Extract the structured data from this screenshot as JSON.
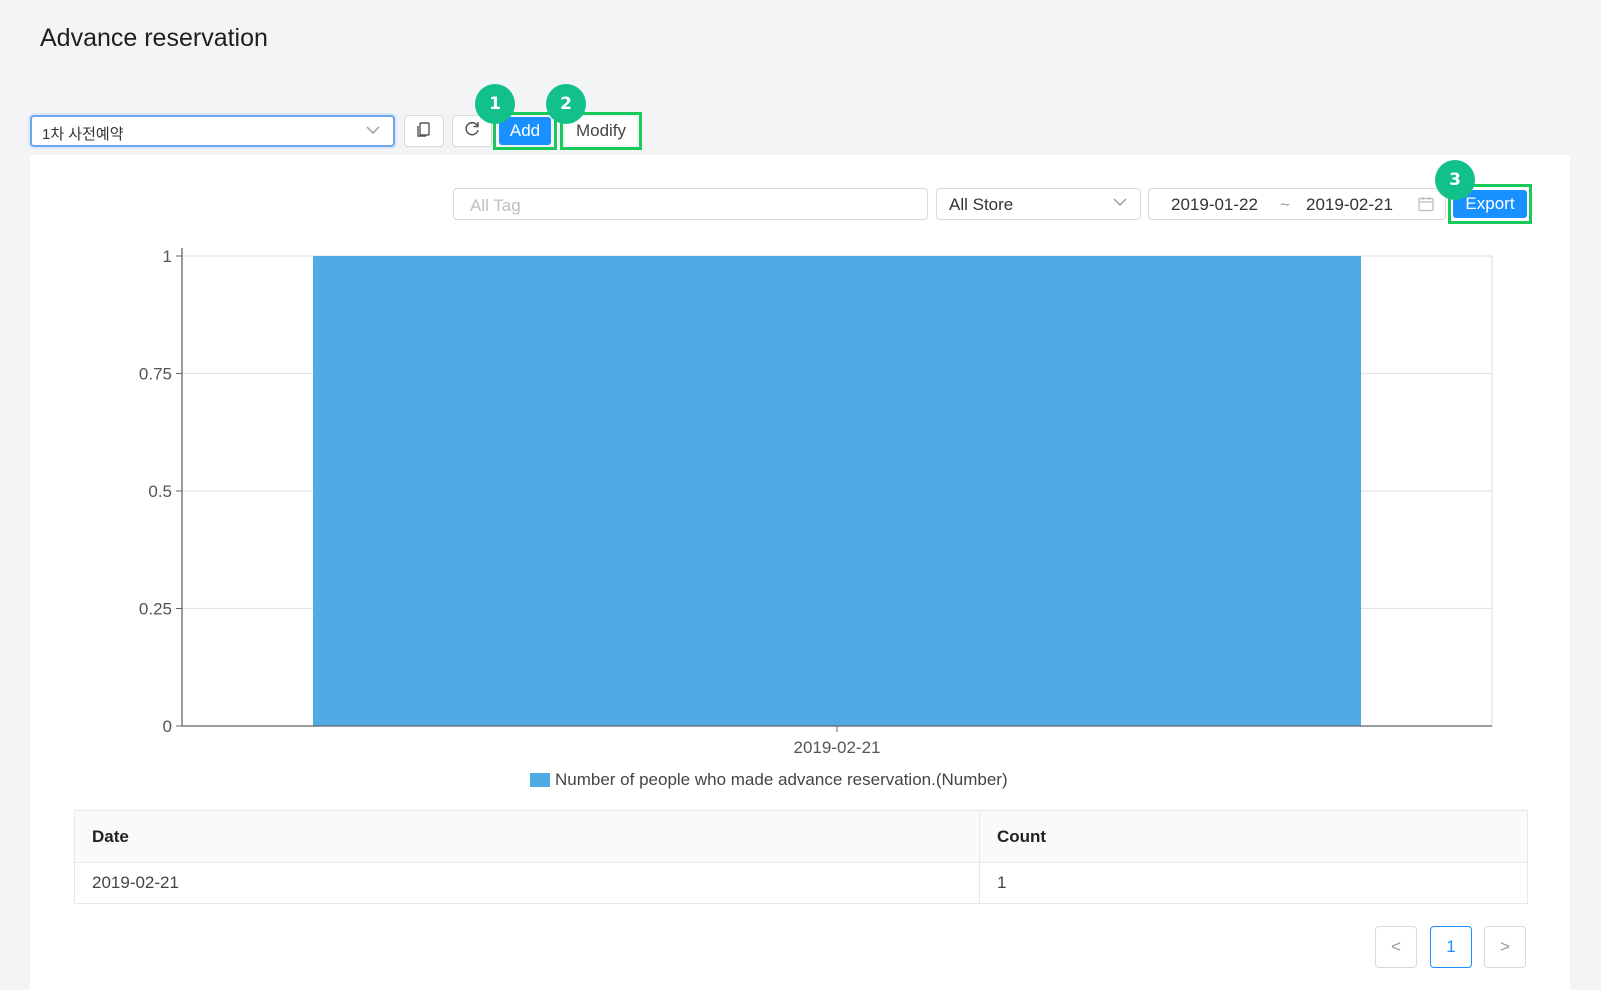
{
  "header": {
    "title": "Advance reservation"
  },
  "toolbar": {
    "reservation_select_value": "1차 사전예약",
    "add_label": "Add",
    "modify_label": "Modify"
  },
  "annotations": {
    "marker_1": "1",
    "marker_2": "2",
    "marker_3": "3"
  },
  "filters": {
    "tag_placeholder": "All Tag",
    "store_value": "All Store",
    "date_from": "2019-01-22",
    "date_separator": "~",
    "date_to": "2019-02-21",
    "export_label": "Export"
  },
  "chart_data": {
    "type": "bar",
    "categories": [
      "2019-02-21"
    ],
    "series": [
      {
        "name": "Number of people who made advance reservation.(Number)",
        "values": [
          1
        ]
      }
    ],
    "ylim": [
      0,
      1
    ],
    "yticks": [
      "0",
      "0.25",
      "0.5",
      "0.75",
      "1"
    ],
    "grid": true,
    "legend_position": "bottom",
    "bar_color": "#50aae3"
  },
  "table": {
    "headers": [
      "Date",
      "Count"
    ],
    "rows": [
      [
        "2019-02-21",
        "1"
      ]
    ]
  },
  "pagination": {
    "prev": "<",
    "current": "1",
    "next": ">"
  },
  "colors": {
    "accent": "#1890ff",
    "highlight": "#19c95a",
    "marker": "#12c08a"
  }
}
